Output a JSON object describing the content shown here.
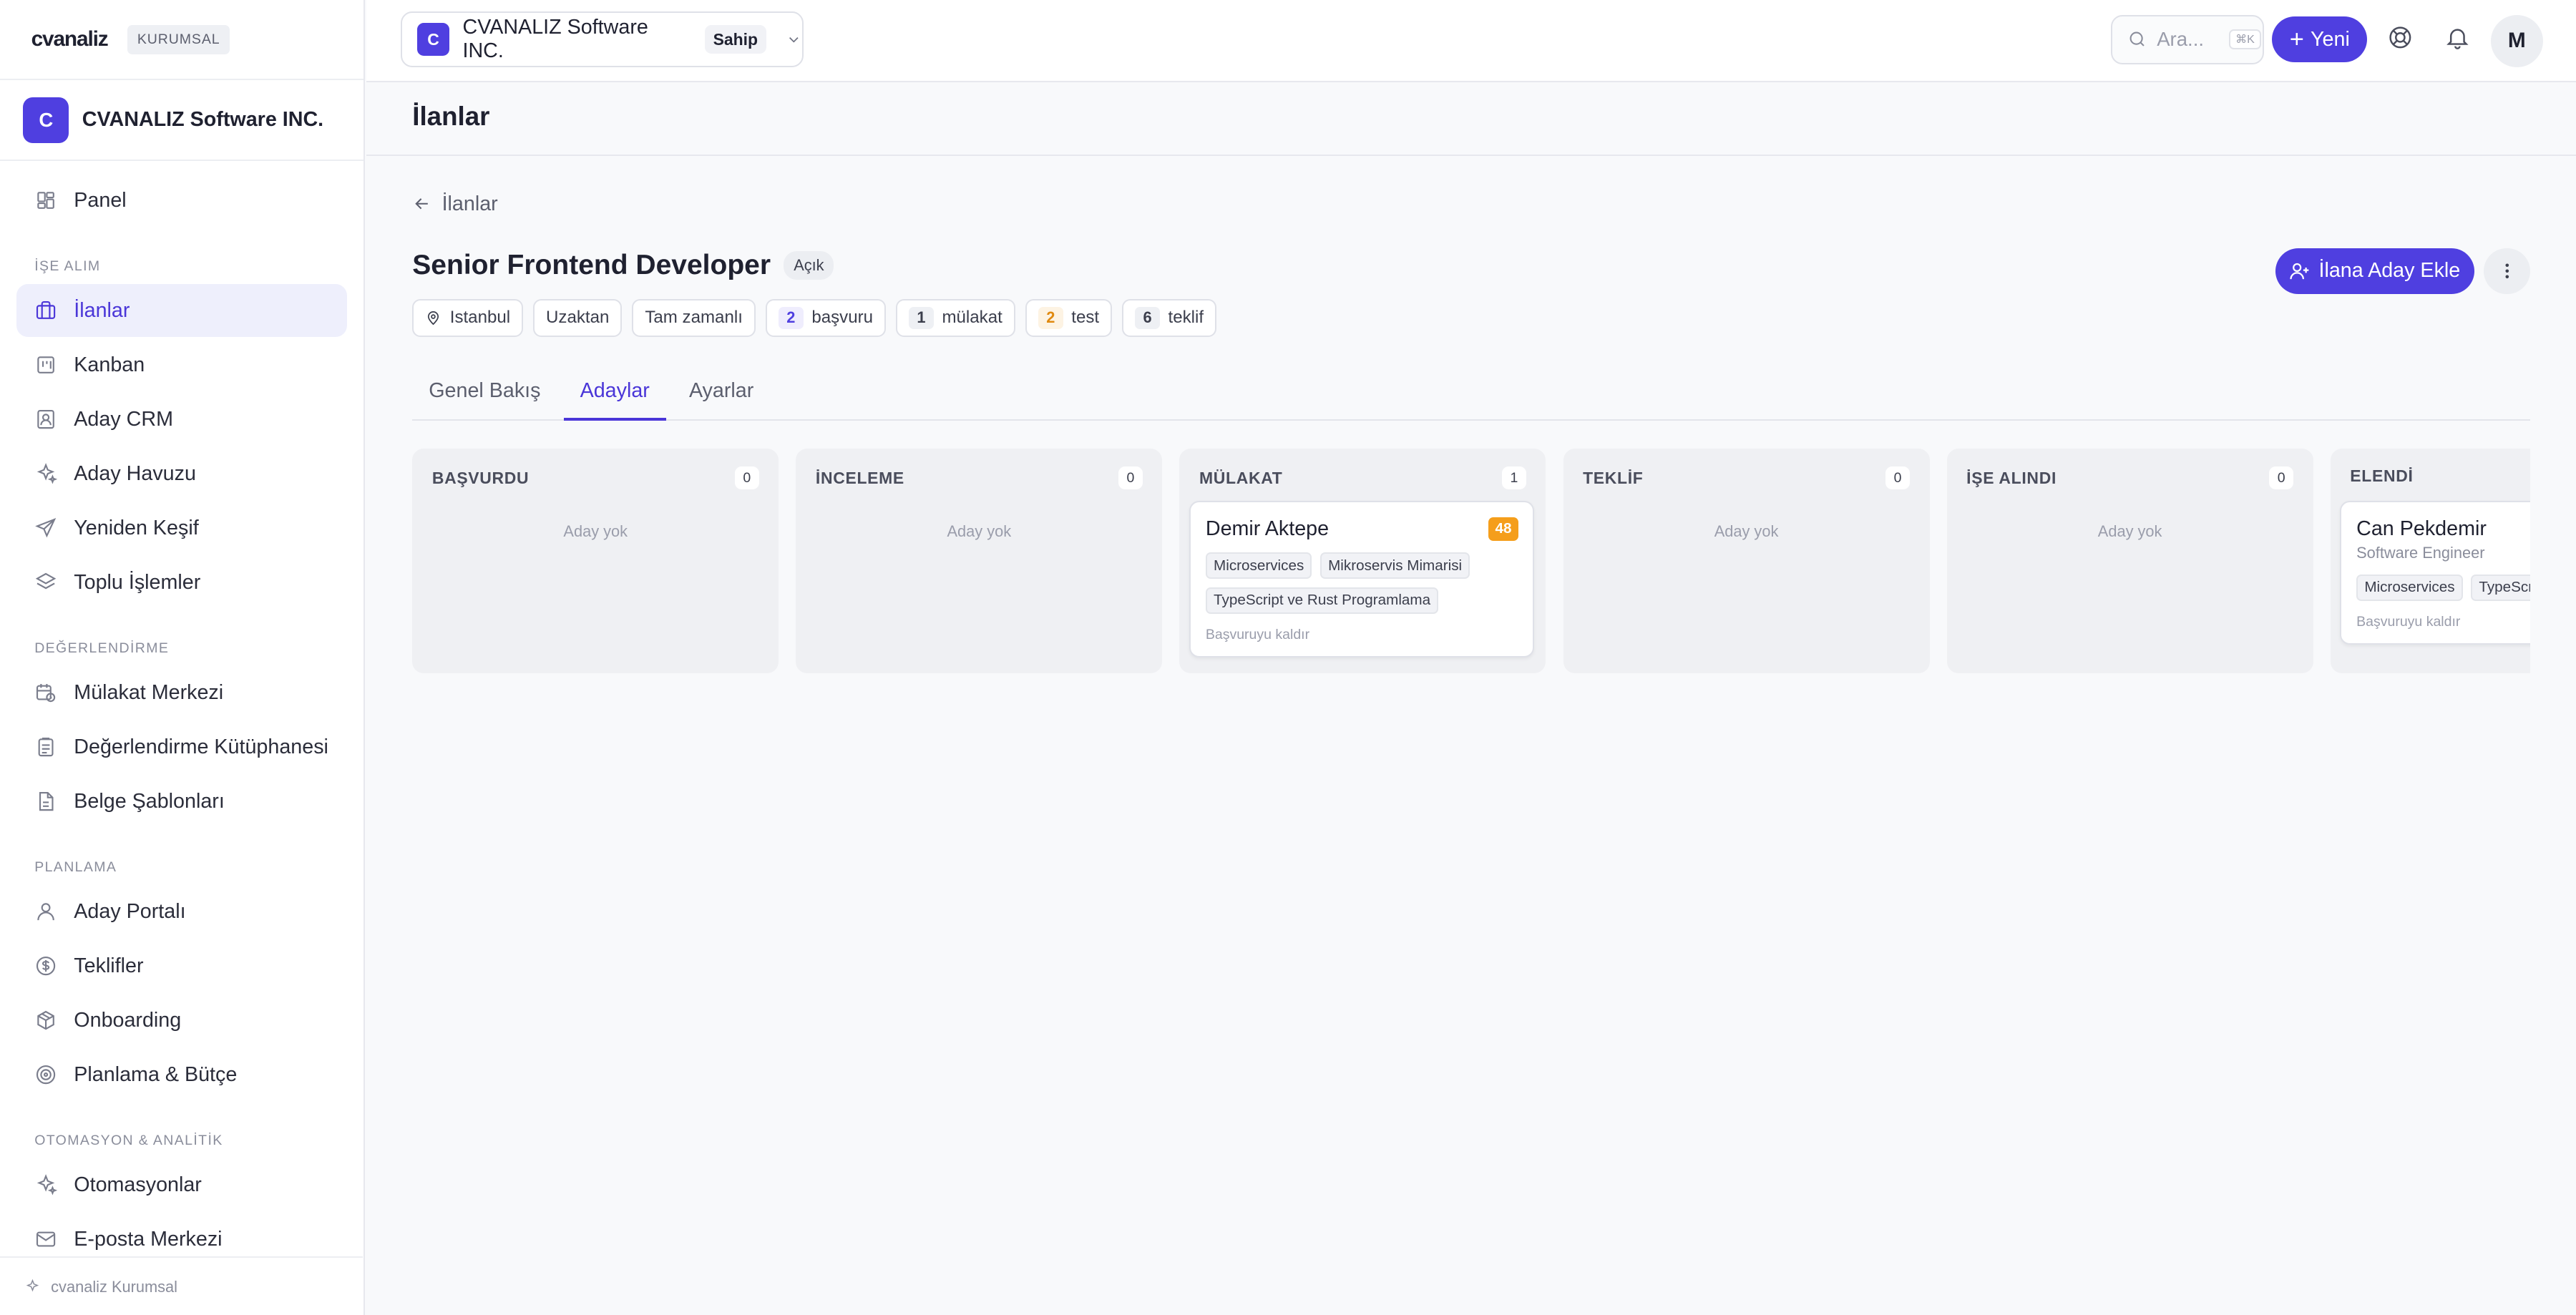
{
  "brand": {
    "logo": "cvanaliz",
    "badge": "KURUMSAL"
  },
  "org": {
    "initial": "C",
    "name": "CVANALIZ Software INC."
  },
  "sidebar": {
    "top": [
      {
        "label": "Panel",
        "icon": "grid-icon"
      }
    ],
    "sections": [
      {
        "title": "İŞE ALIM",
        "items": [
          {
            "label": "İlanlar",
            "icon": "briefcase-icon",
            "active": true
          },
          {
            "label": "Kanban",
            "icon": "kanban-icon"
          },
          {
            "label": "Aday CRM",
            "icon": "contact-icon"
          },
          {
            "label": "Aday Havuzu",
            "icon": "sparkles-icon"
          },
          {
            "label": "Yeniden Keşif",
            "icon": "send-icon"
          },
          {
            "label": "Toplu İşlemler",
            "icon": "layers-icon"
          }
        ]
      },
      {
        "title": "DEĞERLENDİRME",
        "items": [
          {
            "label": "Mülakat Merkezi",
            "icon": "calendar-clock-icon"
          },
          {
            "label": "Değerlendirme Kütüphanesi",
            "icon": "clipboard-icon"
          },
          {
            "label": "Belge Şablonları",
            "icon": "file-icon"
          }
        ]
      },
      {
        "title": "PLANLAMA",
        "items": [
          {
            "label": "Aday Portalı",
            "icon": "user-icon"
          },
          {
            "label": "Teklifler",
            "icon": "dollar-icon"
          },
          {
            "label": "Onboarding",
            "icon": "package-icon"
          },
          {
            "label": "Planlama & Bütçe",
            "icon": "target-icon"
          }
        ]
      },
      {
        "title": "OTOMASYON & ANALİTİK",
        "items": [
          {
            "label": "Otomasyonlar",
            "icon": "sparkles-icon"
          },
          {
            "label": "E-posta Merkezi",
            "icon": "mail-icon"
          }
        ]
      }
    ],
    "footer": "cvanaliz Kurumsal"
  },
  "topbar": {
    "org_initial": "C",
    "org_name": "CVANALIZ Software INC.",
    "role": "Sahip",
    "search_placeholder": "Ara...",
    "search_shortcut": "⌘K",
    "new_label": "Yeni",
    "user_initial": "M"
  },
  "page": {
    "title": "İlanlar",
    "back_label": "İlanlar"
  },
  "job": {
    "title": "Senior Frontend Developer",
    "status": "Açık",
    "location": "Istanbul",
    "work_mode": "Uzaktan",
    "employment": "Tam zamanlı",
    "stats": [
      {
        "count": "2",
        "label": "başvuru",
        "tone": "purple"
      },
      {
        "count": "1",
        "label": "mülakat",
        "tone": "gray"
      },
      {
        "count": "2",
        "label": "test",
        "tone": "orange"
      },
      {
        "count": "6",
        "label": "teklif",
        "tone": "gray"
      }
    ],
    "add_candidate_label": "İlana Aday Ekle"
  },
  "tabs": [
    {
      "label": "Genel Bakış",
      "active": false
    },
    {
      "label": "Adaylar",
      "active": true
    },
    {
      "label": "Ayarlar",
      "active": false
    }
  ],
  "board": {
    "empty_label": "Aday yok",
    "remove_label": "Başvuruyu kaldır",
    "columns": [
      {
        "title": "BAŞVURDU",
        "count": "0",
        "cards": []
      },
      {
        "title": "İNCELEME",
        "count": "0",
        "cards": []
      },
      {
        "title": "MÜLAKAT",
        "count": "1",
        "cards": [
          {
            "name": "Demir Aktepe",
            "subtitle": "",
            "score": "48",
            "tags": [
              "Microservices",
              "Mikroservis Mimarisi",
              "TypeScript ve Rust Programlama"
            ]
          }
        ]
      },
      {
        "title": "TEKLİF",
        "count": "0",
        "cards": []
      },
      {
        "title": "İŞE ALINDI",
        "count": "0",
        "cards": []
      },
      {
        "title": "ELENDİ",
        "count": "",
        "cards": [
          {
            "name": "Can Pekdemir",
            "subtitle": "Software Engineer",
            "score": "",
            "tags": [
              "Microservices",
              "TypeScript"
            ]
          }
        ]
      }
    ]
  }
}
